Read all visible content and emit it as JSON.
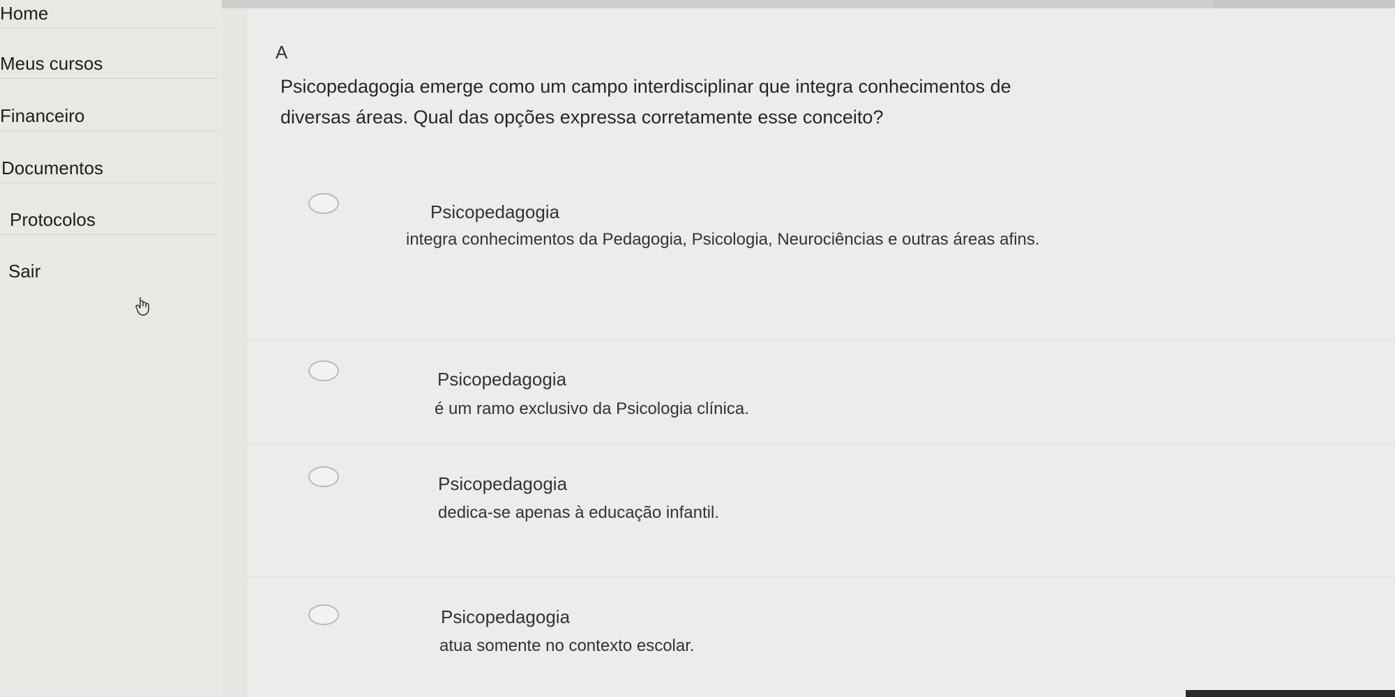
{
  "sidebar": {
    "items": [
      {
        "label": "Home"
      },
      {
        "label": "Meus cursos"
      },
      {
        "label": "Financeiro"
      },
      {
        "label": "Documentos"
      },
      {
        "label": "Protocolos"
      },
      {
        "label": "Sair"
      }
    ]
  },
  "question": {
    "letter": "A",
    "text": "Psicopedagogia emerge como um campo interdisciplinar que integra conhecimentos de diversas áreas. Qual das opções expressa corretamente esse conceito?"
  },
  "options": [
    {
      "title": "Psicopedagogia",
      "description": "integra conhecimentos da Pedagogia, Psicologia, Neurociências e outras áreas afins.",
      "selected": false
    },
    {
      "title": "Psicopedagogia",
      "description": "é um ramo exclusivo da Psicologia clínica.",
      "selected": false
    },
    {
      "title": "Psicopedagogia",
      "description": "dedica-se apenas à educação infantil.",
      "selected": false
    },
    {
      "title": "Psicopedagogia",
      "description": "atua somente no contexto escolar.",
      "selected": false
    }
  ],
  "icons": {
    "cursor": "hand-pointer-icon"
  },
  "colors": {
    "background": "#ececea",
    "sidebar": "#e8e8e4",
    "text": "#2a2a2a"
  }
}
